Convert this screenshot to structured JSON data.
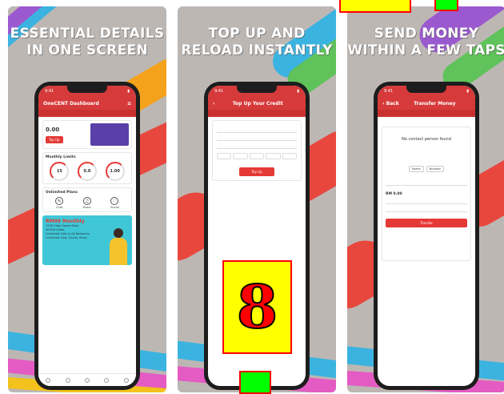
{
  "panels": [
    {
      "caption": [
        "ESSENTIAL DETAILS",
        "IN ONE SCREEN"
      ],
      "screen": {
        "time": "9:41",
        "title": "OneCENT Dashboard",
        "subtitle": "",
        "balance": "0.00",
        "topup_label": "Top Up",
        "section_usage": "Monthly Limits",
        "gauges": [
          "15",
          "0.0",
          "1.00"
        ],
        "section_free": "Unlimited Plans",
        "icons": [
          "Chat",
          "Music",
          "Social"
        ],
        "promo_title": "RM99 Monthly",
        "promo_lines": [
          "15GB High Speed Data",
          "500GB Video",
          "Unlimited Calls & All Networks",
          "Unlimited Chat, Social, Music"
        ]
      }
    },
    {
      "caption": [
        "TOP UP AND",
        "RELOAD INSTANTLY"
      ],
      "screen": {
        "time": "9:41",
        "title": "Top Up Your Credit",
        "subtitle": "",
        "amounts": [
          "",
          "",
          "",
          "",
          ""
        ],
        "button": "Top Up"
      }
    },
    {
      "caption": [
        "SEND MONEY",
        "WITHIN A FEW TAPS"
      ],
      "screen": {
        "time": "9:41",
        "title": "Transfer Money",
        "back_label": "Back",
        "message": "No contact person found",
        "pills": [
          "Name",
          "Number"
        ],
        "amount": "RM 0.00",
        "button": "Transfer"
      }
    }
  ],
  "overlay": {
    "number_badge": "8"
  },
  "colors": {
    "app_red": "#d63a3a",
    "badge_yellow": "#ffff00",
    "badge_border": "#ff0000",
    "green": "#00ff00"
  }
}
